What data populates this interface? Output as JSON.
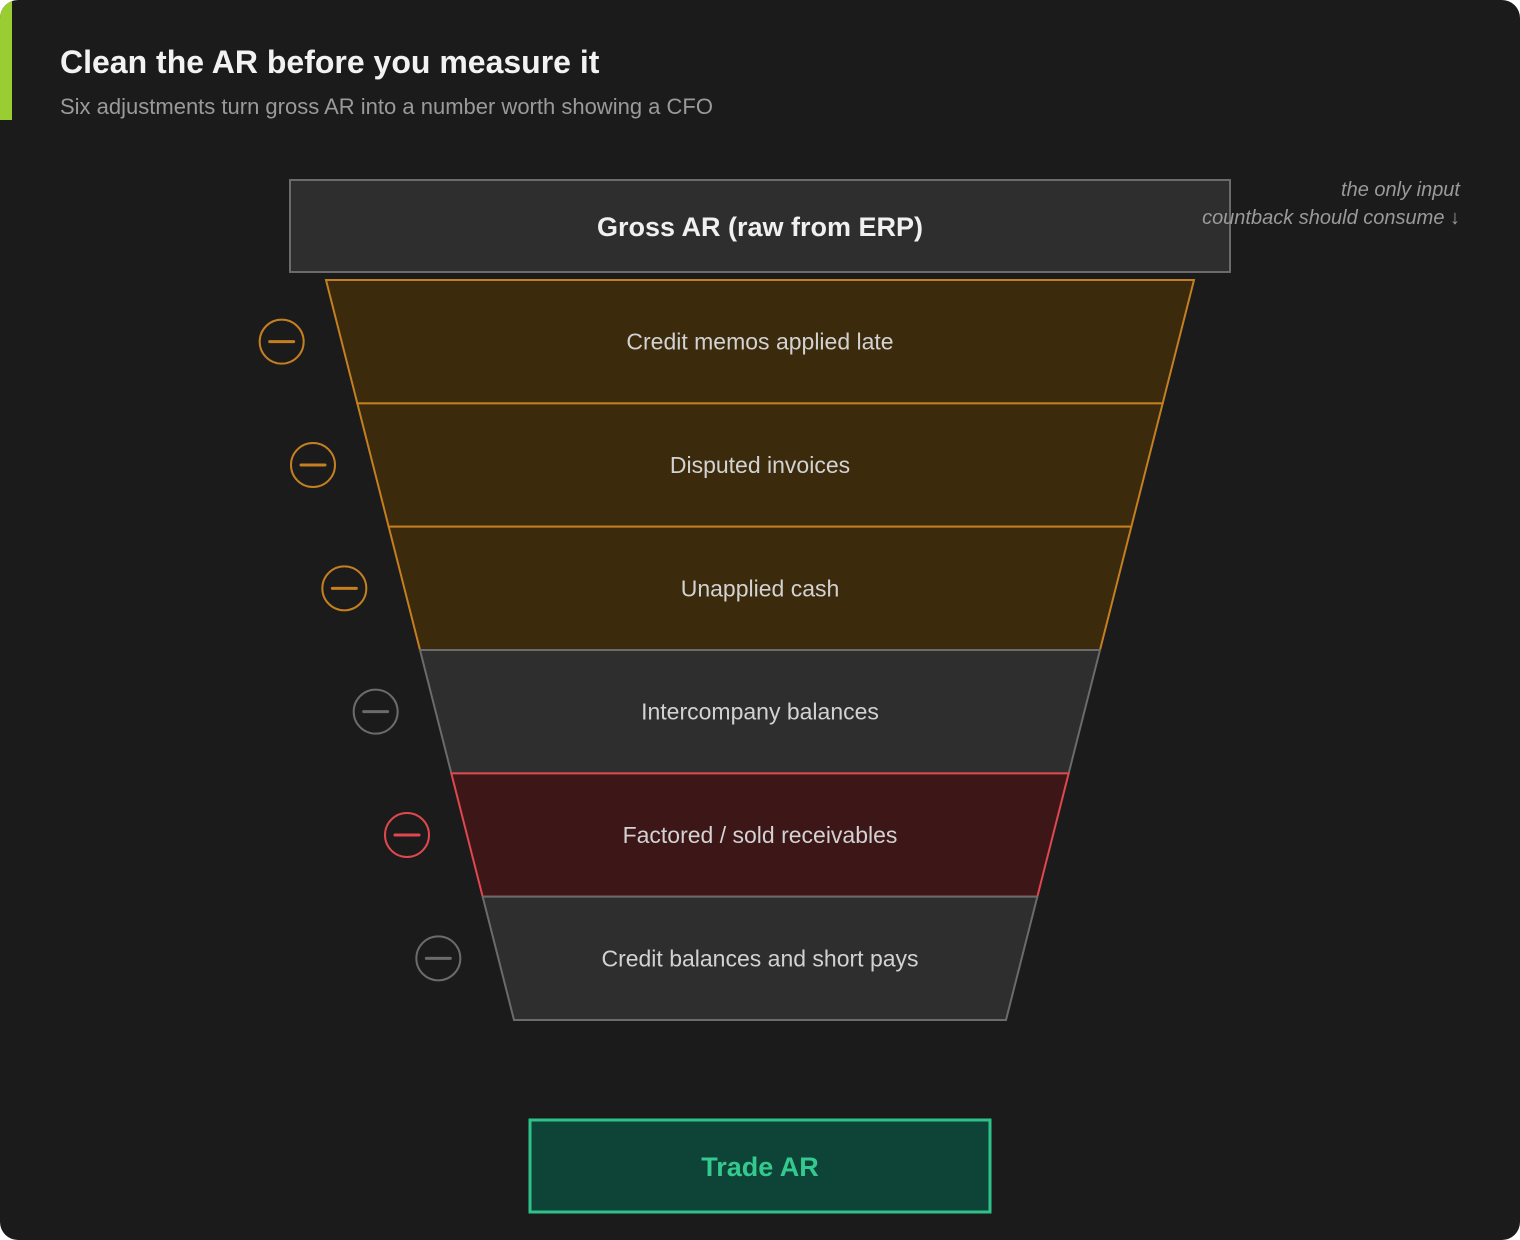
{
  "header": {
    "title": "Clean the AR before you measure it",
    "subtitle": "Six adjustments turn gross AR into a number worth showing a CFO"
  },
  "colors": {
    "accent": "#9acd32",
    "amber_stroke": "#c47f20",
    "amber_fill": "#3b2a0b",
    "gray_stroke": "#6b6b6b",
    "gray_fill": "#2e2e2e",
    "red_stroke": "#e0474f",
    "red_fill": "#3d1617",
    "green_stroke": "#2ec28a",
    "green_fill": "#0d4437",
    "green_text": "#34c98f"
  },
  "top_box": {
    "label": "Gross AR (raw from ERP)"
  },
  "annotation": {
    "line1": "the only input",
    "line2": "countback should consume ↓"
  },
  "funnel": {
    "stages": [
      {
        "label": "Credit memos applied late",
        "tone": "amber",
        "icon": "minus-circle-icon"
      },
      {
        "label": "Disputed invoices",
        "tone": "amber",
        "icon": "minus-circle-icon"
      },
      {
        "label": "Unapplied cash",
        "tone": "amber",
        "icon": "minus-circle-icon"
      },
      {
        "label": "Intercompany balances",
        "tone": "gray",
        "icon": "minus-circle-icon"
      },
      {
        "label": "Factored / sold receivables",
        "tone": "red",
        "icon": "minus-circle-icon"
      },
      {
        "label": "Credit balances and short pays",
        "tone": "gray",
        "icon": "minus-circle-icon"
      }
    ]
  },
  "result_box": {
    "label": "Trade AR"
  }
}
